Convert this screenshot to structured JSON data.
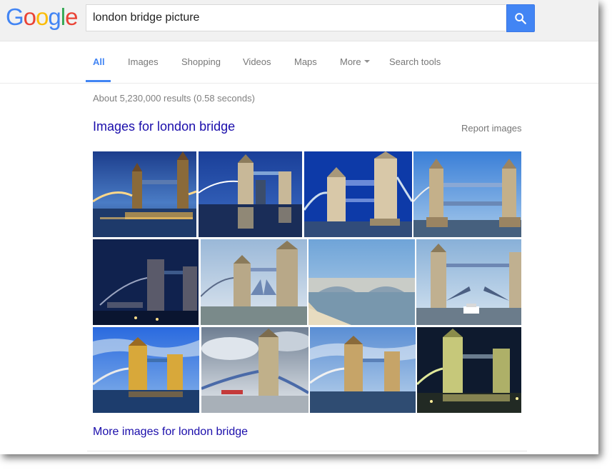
{
  "logo": {
    "letters": [
      "G",
      "o",
      "o",
      "g",
      "l",
      "e"
    ],
    "colors": [
      "#4285f4",
      "#ea4335",
      "#fbbc05",
      "#4285f4",
      "#34a853",
      "#ea4335"
    ]
  },
  "search": {
    "query": "london bridge picture",
    "button_icon": "search-icon"
  },
  "nav": {
    "tabs": [
      "All",
      "Images",
      "Shopping",
      "Videos",
      "Maps",
      "More",
      "Search tools"
    ],
    "active": "All"
  },
  "results": {
    "stats": "About 5,230,000 results (0.58 seconds)"
  },
  "images_section": {
    "title": "Images for london bridge",
    "report": "Report images",
    "more_link": "More images for london bridge"
  },
  "colors": {
    "link": "#1a0dab",
    "accent": "#4285f4",
    "muted": "#777777"
  }
}
